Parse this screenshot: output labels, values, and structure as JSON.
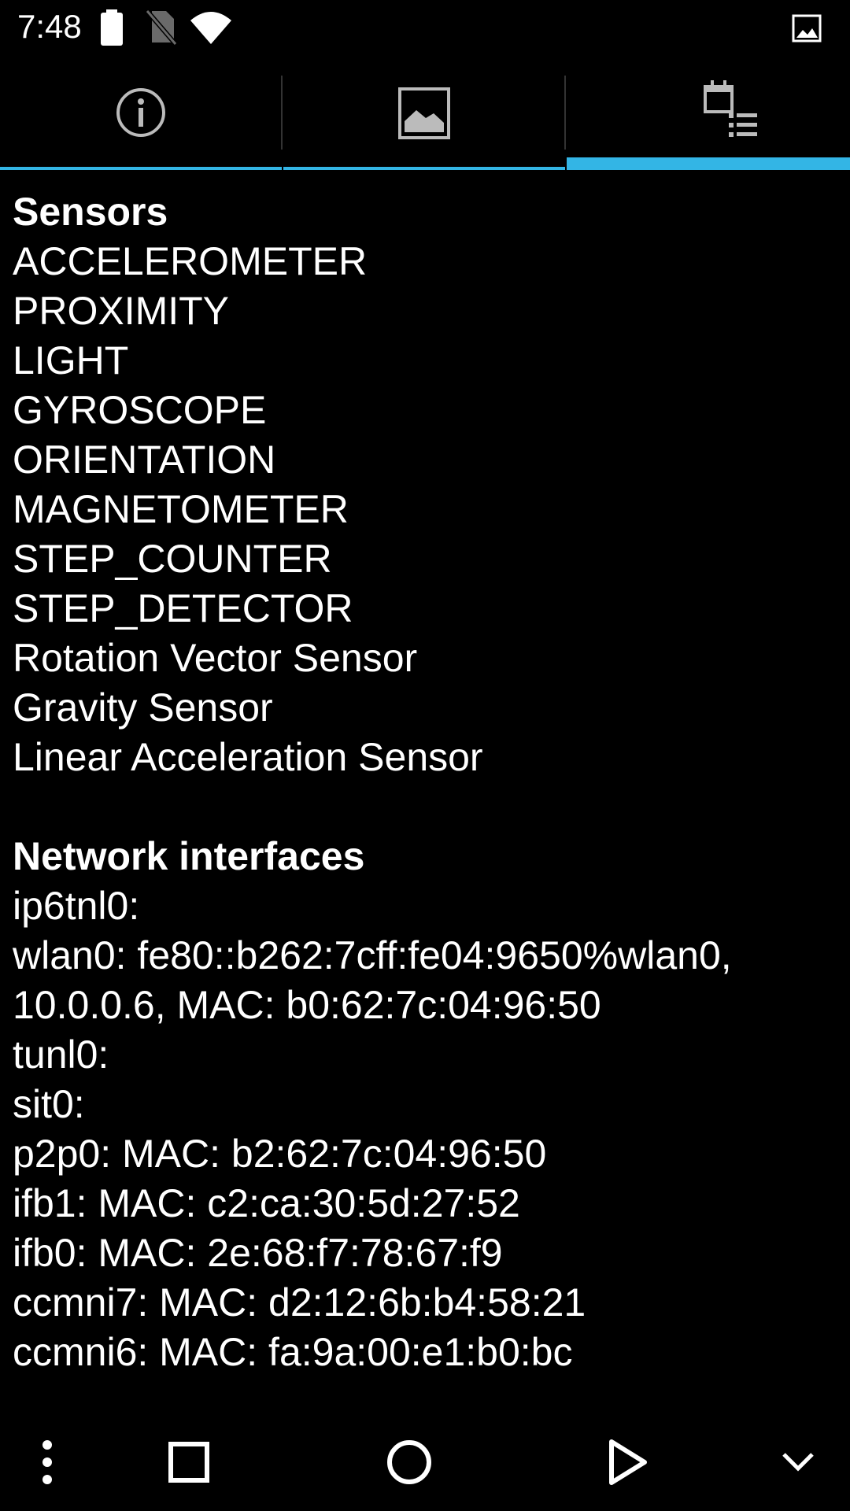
{
  "status_bar": {
    "time": "7:48",
    "icons": [
      "battery-icon",
      "no-sim-icon",
      "wifi-icon",
      "image-notification-icon"
    ]
  },
  "tabs": [
    {
      "name": "info",
      "icon": "info-icon",
      "selected": false
    },
    {
      "name": "image",
      "icon": "image-icon",
      "selected": false
    },
    {
      "name": "sensors-list",
      "icon": "calendar-list-icon",
      "selected": true
    }
  ],
  "sensors": {
    "title": "Sensors",
    "items": [
      "ACCELEROMETER",
      "PROXIMITY",
      "LIGHT",
      "GYROSCOPE",
      "ORIENTATION",
      "MAGNETOMETER",
      "STEP_COUNTER",
      "STEP_DETECTOR",
      "Rotation Vector Sensor",
      "Gravity Sensor",
      "Linear Acceleration Sensor"
    ]
  },
  "network": {
    "title": "Network interfaces",
    "items": [
      "ip6tnl0:",
      "wlan0: fe80::b262:7cff:fe04:9650%wlan0,",
      "10.0.0.6, MAC: b0:62:7c:04:96:50",
      "tunl0:",
      "sit0:",
      "p2p0: MAC: b2:62:7c:04:96:50",
      "ifb1: MAC: c2:ca:30:5d:27:52",
      "ifb0: MAC: 2e:68:f7:78:67:f9",
      "ccmni7: MAC: d2:12:6b:b4:58:21",
      "ccmni6: MAC: fa:9a:00:e1:b0:bc"
    ]
  },
  "nav_bar": {
    "buttons": [
      "menu-icon",
      "recents-icon",
      "home-icon",
      "back-icon",
      "collapse-icon"
    ]
  },
  "colors": {
    "accent": "#33b5e5",
    "background": "#000000",
    "text": "#ffffff"
  }
}
